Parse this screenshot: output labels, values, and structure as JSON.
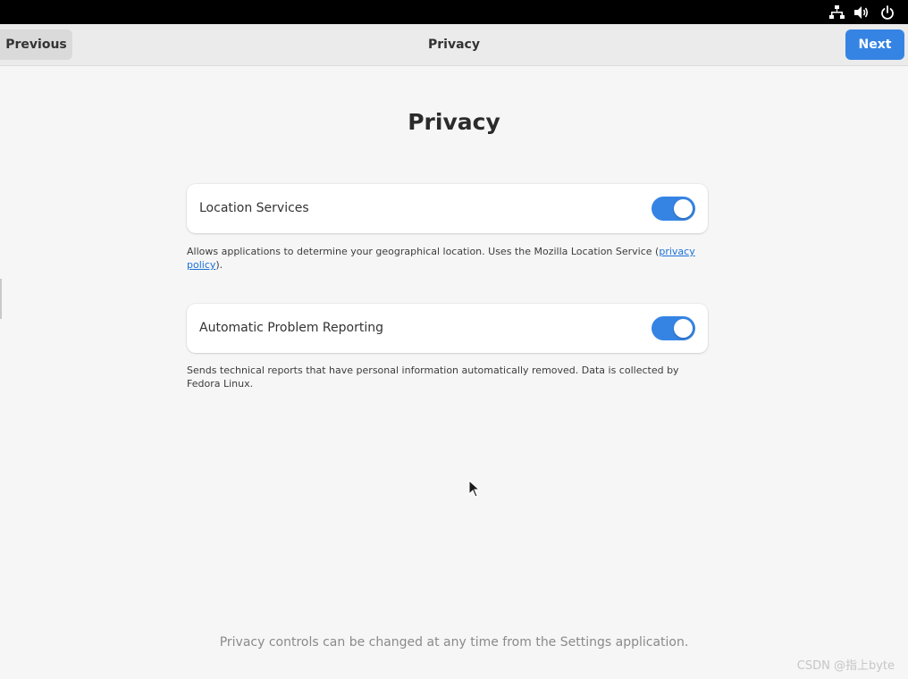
{
  "colors": {
    "accent": "#3584e4",
    "topbar": "#000000",
    "headerbar": "#ebebeb",
    "background": "#f6f6f6",
    "link": "#1c71d8"
  },
  "system_tray": {
    "icons": [
      "network-icon",
      "volume-icon",
      "power-icon"
    ]
  },
  "header": {
    "previous_label": "Previous",
    "title": "Privacy",
    "next_label": "Next"
  },
  "main": {
    "heading": "Privacy",
    "settings": [
      {
        "label": "Location Services",
        "enabled": true,
        "description": "Allows applications to determine your geographical location. Uses the Mozilla Location Service (",
        "link_text": "privacy policy",
        "description_after": ")."
      },
      {
        "label": "Automatic Problem Reporting",
        "enabled": true,
        "description": "Sends technical reports that have personal information automatically removed. Data is collected by Fedora Linux."
      }
    ],
    "footer_note": "Privacy controls can be changed at any time from the Settings application."
  },
  "watermark": "CSDN @指上byte"
}
